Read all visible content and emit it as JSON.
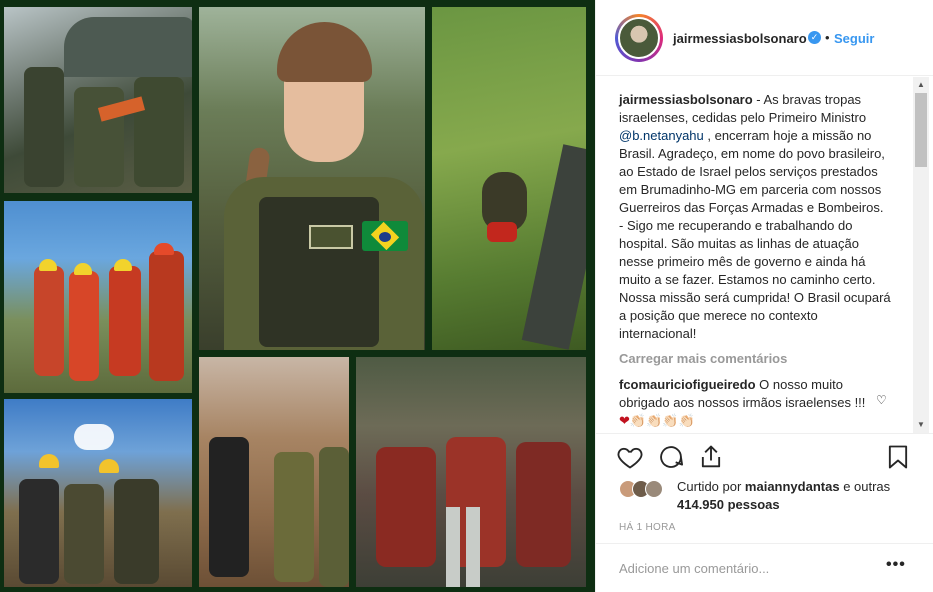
{
  "post": {
    "username": "jairmessiasbolsonaro",
    "follow_label": "Seguir",
    "caption_user": "jairmessiasbolsonaro",
    "caption_part1": " - As bravas tropas israelenses, cedidas pelo Primeiro Ministro ",
    "caption_mention": "@b.netanyahu",
    "caption_part2": " , encerram hoje a missão no Brasil. Agradeço, em nome do povo brasileiro, ao Estado de Israel pelos serviços prestados em Brumadinho-MG em parceria com nossos Guerreiros das Forças Armadas e Bombeiros. - Sigo me recuperando e trabalhando do hospital. São muitas as linhas de atuação nesse primeiro mês de governo e ainda há muito a se fazer. Estamos no caminho certo. Nossa missão será cumprida! O Brasil ocupará a posição que merece no contexto internacional!",
    "load_more": "Carregar mais comentários",
    "comment_user": "fcomauriciofigueiredo",
    "comment_text": " O nosso muito obrigado aos nossos irmãos israelenses !!!",
    "comment_emoji": "❤👏🏻👏🏻👏🏻👏🏻",
    "liked_by_prefix": "Curtido por ",
    "liked_by_user": "maiannydantas",
    "liked_by_mid": " e outras ",
    "liked_by_count": "414.950 pessoas",
    "time_ago": "HÁ 1 HORA",
    "add_comment_placeholder": "Adicione um comentário...",
    "more_label": "•••"
  },
  "icons": {
    "verified": "verified-badge-icon",
    "heart": "heart-icon",
    "comment": "comment-bubble-icon",
    "share": "share-icon",
    "save": "bookmark-icon"
  },
  "colors": {
    "link_blue": "#3897f0",
    "mention": "#003569",
    "frame_green": "#0e2e12"
  }
}
